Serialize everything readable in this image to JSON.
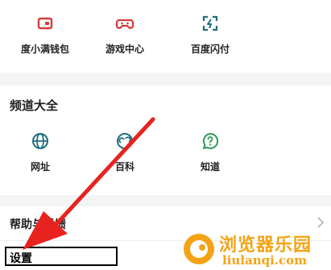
{
  "top_services": [
    {
      "label": "度小满钱包",
      "icon": "wallet-icon"
    },
    {
      "label": "游戏中心",
      "icon": "gamepad-icon"
    },
    {
      "label": "百度闪付",
      "icon": "scan-pay-icon"
    }
  ],
  "channels": {
    "title": "频道大全",
    "items": [
      {
        "label": "网址",
        "icon": "globe-icon"
      },
      {
        "label": "百科",
        "icon": "encyclopedia-icon"
      },
      {
        "label": "知道",
        "icon": "question-bubble-icon"
      }
    ]
  },
  "help_row": {
    "label": "帮助与反馈",
    "icon": "chevron-right-icon"
  },
  "settings_row": {
    "label": "设置"
  },
  "annotation": {
    "color": "#e8231f",
    "box_color": "#000000"
  },
  "watermark": {
    "cn": "浏览器乐园",
    "en": "liulanqi.com"
  },
  "colors": {
    "icon_red": "#d63b3b",
    "icon_teal": "#1f6f7e",
    "icon_green": "#2e9a5a",
    "watermark": "#f4a316",
    "separator": "#f3f4f6"
  }
}
